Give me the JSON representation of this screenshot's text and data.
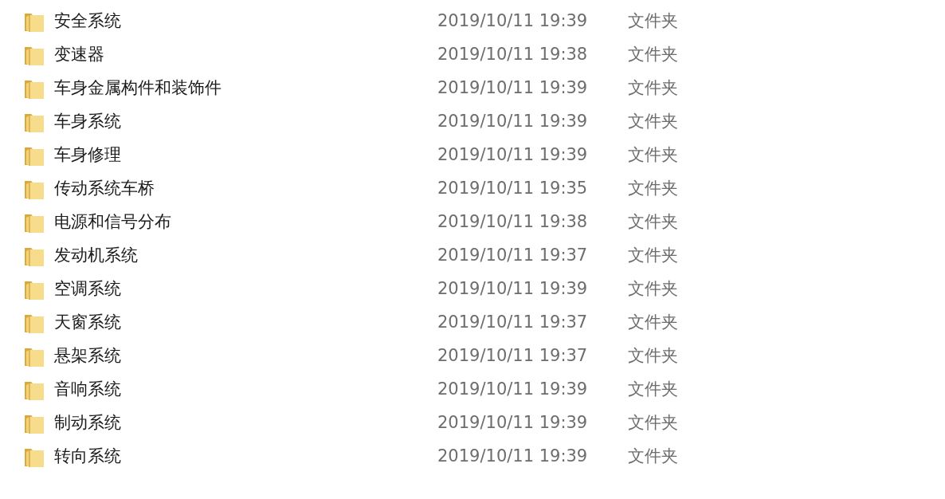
{
  "files": [
    {
      "name": "安全系统",
      "modified": "2019/10/11 19:39",
      "type": "文件夹"
    },
    {
      "name": "变速器",
      "modified": "2019/10/11 19:38",
      "type": "文件夹"
    },
    {
      "name": "车身金属构件和装饰件",
      "modified": "2019/10/11 19:39",
      "type": "文件夹"
    },
    {
      "name": "车身系统",
      "modified": "2019/10/11 19:39",
      "type": "文件夹"
    },
    {
      "name": "车身修理",
      "modified": "2019/10/11 19:39",
      "type": "文件夹"
    },
    {
      "name": "传动系统车桥",
      "modified": "2019/10/11 19:35",
      "type": "文件夹"
    },
    {
      "name": "电源和信号分布",
      "modified": "2019/10/11 19:38",
      "type": "文件夹"
    },
    {
      "name": "发动机系统",
      "modified": "2019/10/11 19:37",
      "type": "文件夹"
    },
    {
      "name": "空调系统",
      "modified": "2019/10/11 19:39",
      "type": "文件夹"
    },
    {
      "name": "天窗系统",
      "modified": "2019/10/11 19:37",
      "type": "文件夹"
    },
    {
      "name": "悬架系统",
      "modified": "2019/10/11 19:37",
      "type": "文件夹"
    },
    {
      "name": "音响系统",
      "modified": "2019/10/11 19:39",
      "type": "文件夹"
    },
    {
      "name": "制动系统",
      "modified": "2019/10/11 19:39",
      "type": "文件夹"
    },
    {
      "name": "转向系统",
      "modified": "2019/10/11 19:39",
      "type": "文件夹"
    }
  ]
}
